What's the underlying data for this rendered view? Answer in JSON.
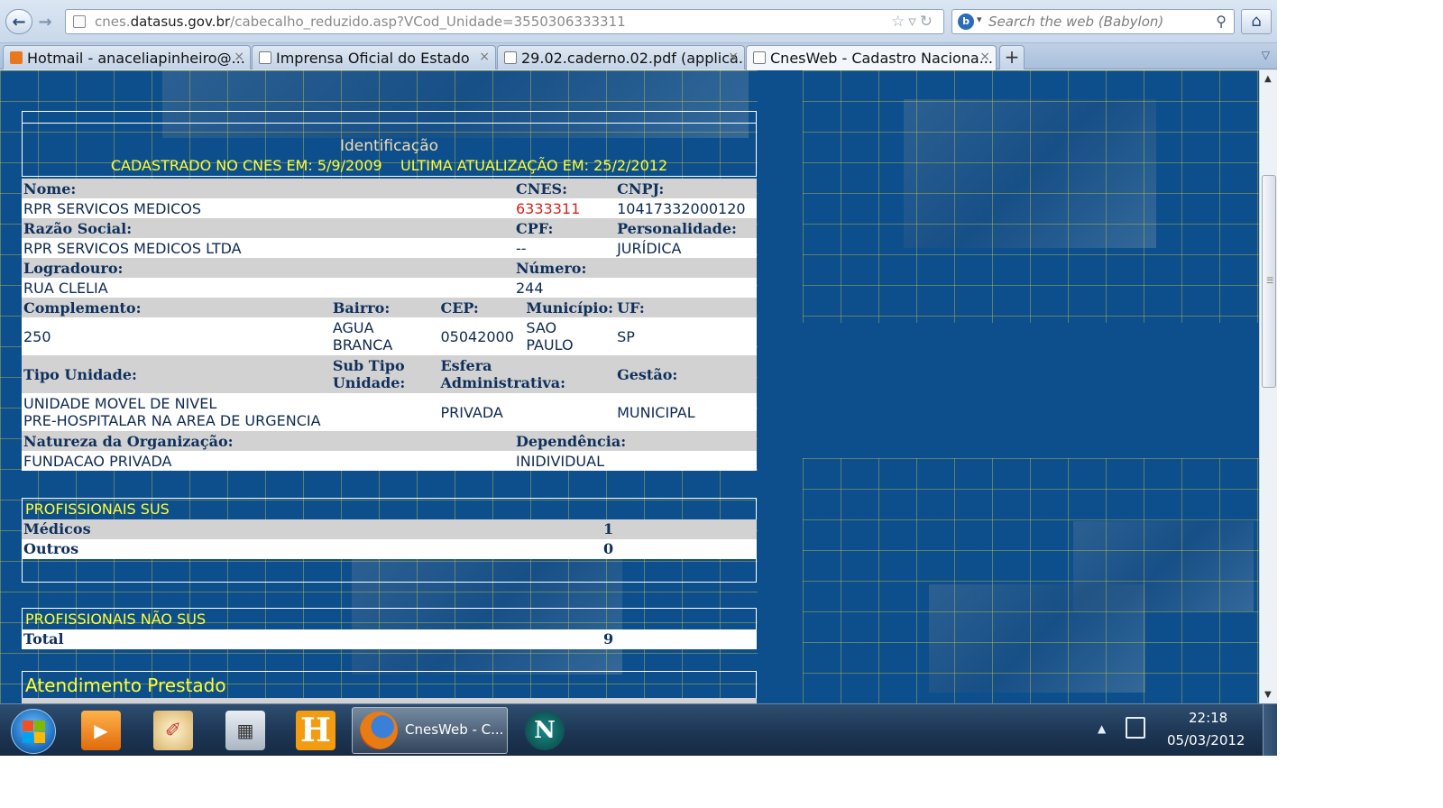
{
  "browser": {
    "url_prefix": "cnes.",
    "url_domain": "datasus.gov.br",
    "url_path": "/cabecalho_reduzido.asp?VCod_Unidade=3550306333311",
    "search_placeholder": "Search the web (Babylon)",
    "tabs": [
      {
        "label": "Hotmail - anaceliapinheiro@...",
        "icon": "mail-icon"
      },
      {
        "label": "Imprensa Oficial do Estado",
        "icon": "page-icon"
      },
      {
        "label": "29.02.caderno.02.pdf (applica...",
        "icon": "page-icon"
      },
      {
        "label": "CnesWeb - Cadastro Naciona...",
        "icon": "page-icon",
        "active": true
      }
    ],
    "new_tab": "+"
  },
  "identificacao": {
    "title": "Identificação",
    "cadastrado": "CADASTRADO NO CNES EM: 5/9/2009",
    "atualizacao": "ULTIMA ATUALIZAÇÃO EM: 25/2/2012",
    "labels": {
      "nome": "Nome:",
      "cnes": "CNES:",
      "cnpj": "CNPJ:",
      "razao_social": "Razão Social:",
      "cpf": "CPF:",
      "personalidade": "Personalidade:",
      "logradouro": "Logradouro:",
      "numero": "Número:",
      "complemento": "Complemento:",
      "bairro": "Bairro:",
      "cep": "CEP:",
      "municipio": "Município:",
      "uf": "UF:",
      "tipo_unidade": "Tipo Unidade:",
      "sub_tipo_1": "Sub Tipo",
      "sub_tipo_2": "Unidade:",
      "esfera_1": "Esfera",
      "esfera_2": "Administrativa:",
      "gestao": "Gestão:",
      "natureza": "Natureza da Organização:",
      "dependencia": "Dependência:"
    },
    "values": {
      "nome": "RPR SERVICOS MEDICOS",
      "cnes": "6333311",
      "cnpj": "10417332000120",
      "razao_social": "RPR SERVICOS MEDICOS LTDA",
      "cpf": "--",
      "personalidade": "JURÍDICA",
      "logradouro": "RUA CLELIA",
      "numero": "244",
      "complemento": "250",
      "bairro_1": "AGUA",
      "bairro_2": "BRANCA",
      "cep": "05042000",
      "municipio_1": "SAO",
      "municipio_2": "PAULO",
      "uf": "SP",
      "tipo_unidade_1": "UNIDADE MOVEL DE NIVEL",
      "tipo_unidade_2": "PRE-HOSPITALAR NA AREA DE URGENCIA",
      "esfera": "PRIVADA",
      "gestao": "MUNICIPAL",
      "natureza": "FUNDACAO PRIVADA",
      "dependencia": "INIDIVIDUAL"
    }
  },
  "profissionais_sus": {
    "title": "PROFISSIONAIS SUS",
    "rows": [
      {
        "label": "Médicos",
        "value": "1"
      },
      {
        "label": "Outros",
        "value": "0"
      }
    ]
  },
  "profissionais_nao_sus": {
    "title": "PROFISSIONAIS NÃO SUS",
    "total_label": "Total",
    "total_value": "9"
  },
  "atendimento": {
    "title": "Atendimento Prestado"
  },
  "taskbar": {
    "firefox_label": "CnesWeb - C...",
    "time": "22:18",
    "date": "05/03/2012"
  },
  "colors": {
    "page_background": "#0d4f8c",
    "highlight_yellow": "#ffff33",
    "highlight_red": "#d6231f",
    "label_row_gray": "#d2d2d2"
  }
}
